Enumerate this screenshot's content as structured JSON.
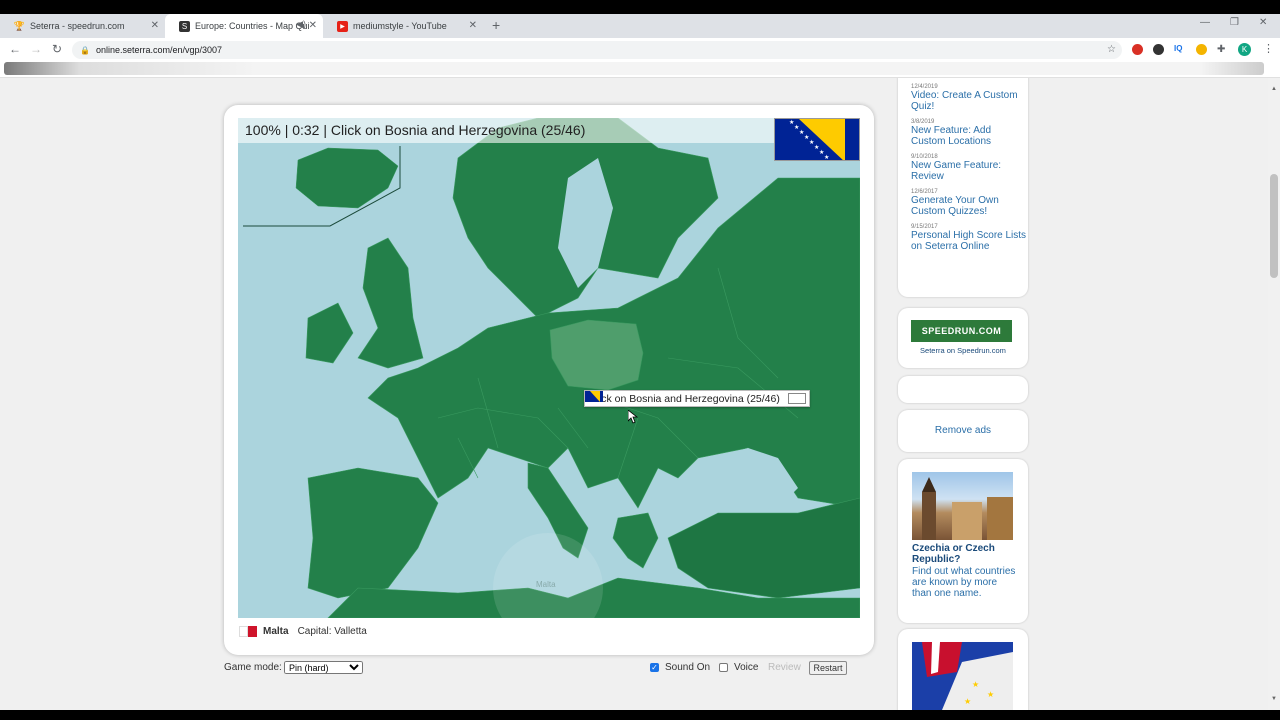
{
  "browser": {
    "tabs": [
      {
        "title": "Seterra - speedrun.com",
        "icon": "trophy-icon"
      },
      {
        "title": "Europe: Countries - Map Qui",
        "icon": "seterra-icon"
      },
      {
        "title": "mediumstyle - YouTube",
        "icon": "youtube-icon"
      }
    ],
    "url": "online.seterra.com/en/vgp/3007",
    "profile_initial": "K"
  },
  "game": {
    "question_bar": "100% | 0:32 | Click on Bosnia and Herzegovina (25/46)",
    "tooltip": "Click on Bosnia and Herzegovina (25/46)",
    "map_label_malta": "Malta",
    "last_country": "Malta",
    "capital": "Capital: Valletta"
  },
  "controls": {
    "game_mode_label": "Game mode:",
    "game_mode_value": "Pin (hard)",
    "sound_label": "Sound On",
    "sound_checked": true,
    "voice_label": "Voice",
    "voice_checked": false,
    "review_label": "Review",
    "restart_label": "Restart"
  },
  "sidebar": {
    "news": [
      {
        "date": "12/4/2019",
        "title": "Video: Create A Custom Quiz!"
      },
      {
        "date": "3/8/2019",
        "title": "New Feature: Add Custom Locations"
      },
      {
        "date": "9/10/2018",
        "title": "New Game Feature: Review"
      },
      {
        "date": "12/6/2017",
        "title": "Generate Your Own Custom Quizzes!"
      },
      {
        "date": "9/15/2017",
        "title": "Personal High Score Lists on Seterra Online"
      }
    ],
    "speedrun_logo": "SPEEDRUN.COM",
    "speedrun_caption": "Seterra on Speedrun.com",
    "remove_ads": "Remove ads",
    "article_title": "Czechia or Czech Republic?",
    "article_text": "Find out what countries are known by more than one name."
  },
  "colors": {
    "land": "#23804a",
    "sea": "#abd4dd",
    "highlight": "#4f9e6c",
    "link": "#2b6fa8"
  }
}
